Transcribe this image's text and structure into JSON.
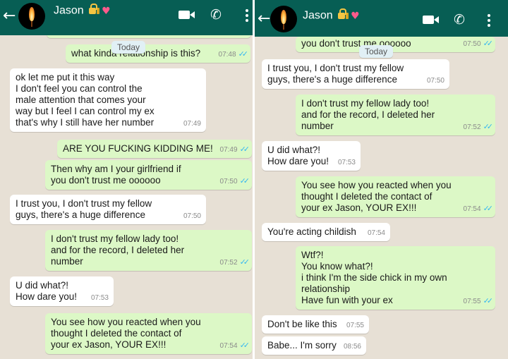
{
  "colors": {
    "header": "#075e54",
    "incoming": "#ffffff",
    "outgoing": "#dcf8c6",
    "background": "#e7e0d5",
    "ticks": "#34b7f1"
  },
  "header": {
    "contact_name": "Jason",
    "icons": [
      "back-arrow-icon",
      "avatar",
      "lock-key-emoji",
      "heart-emoji",
      "video-call-icon",
      "phone-call-icon",
      "more-options-icon"
    ]
  },
  "date_chip": "Today",
  "left": {
    "messages": [
      {
        "dir": "out",
        "text": "what kinda relationship is this?",
        "time": "07:48",
        "read": true
      },
      {
        "dir": "in",
        "text": "ok let me put it this way\nI don't feel you can control the\nmale attention that comes your\nway but I feel I can control my ex\nthat's why I still have her number",
        "time": "07:49"
      },
      {
        "dir": "out",
        "text": "ARE YOU FUCKING KIDDING ME!",
        "time": "07:49",
        "read": true
      },
      {
        "dir": "out",
        "text": "Then why am I your girlfriend if\nyou don't trust me oooooo",
        "time": "07:50",
        "read": true
      },
      {
        "dir": "in",
        "text": "I trust you, I don't trust my fellow\nguys, there's a huge difference",
        "time": "07:50"
      },
      {
        "dir": "out",
        "text": "I don't trust my fellow lady too!\nand for the record, I deleted her\nnumber",
        "time": "07:52",
        "read": true
      },
      {
        "dir": "in",
        "text": "U did what?!\nHow dare you!",
        "time": "07:53"
      },
      {
        "dir": "out",
        "text": "You see how you reacted when you\nthought I deleted the contact of\nyour ex Jason, YOUR EX!!!",
        "time": "07:54",
        "read": true
      }
    ]
  },
  "right": {
    "messages": [
      {
        "dir": "out",
        "text": "you don't trust me oooooo",
        "time": "07:50",
        "read": true
      },
      {
        "dir": "in",
        "text": "I trust you, I don't trust my fellow\nguys, there's a huge difference",
        "time": "07:50"
      },
      {
        "dir": "out",
        "text": "I don't trust my fellow lady too!\nand for the record, I deleted her\nnumber",
        "time": "07:52",
        "read": true
      },
      {
        "dir": "in",
        "text": "U did what?!\nHow dare you!",
        "time": "07:53"
      },
      {
        "dir": "out",
        "text": "You see how you reacted when you\nthought I deleted the contact of\nyour ex Jason, YOUR EX!!!",
        "time": "07:54",
        "read": true
      },
      {
        "dir": "in",
        "text": "You're acting childish",
        "time": "07:54"
      },
      {
        "dir": "out",
        "text": "Wtf?!\nYou know what?!\ni think I'm the side chick in my own\nrelationship\nHave fun with your ex",
        "time": "07:55",
        "read": true
      },
      {
        "dir": "in",
        "text": "Don't be like this",
        "time": "07:55"
      },
      {
        "dir": "in",
        "text": "Babe... I'm sorry",
        "time": "08:56"
      }
    ]
  }
}
